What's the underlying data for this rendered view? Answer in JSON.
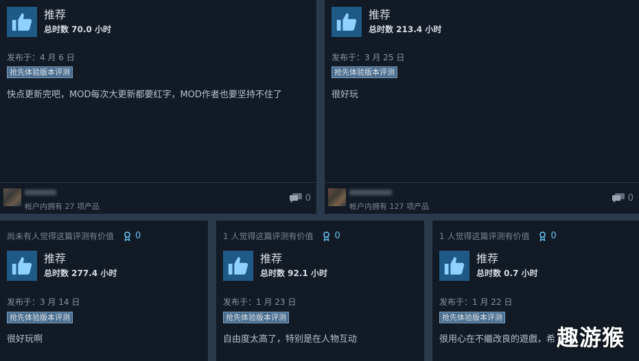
{
  "reviews_top": [
    {
      "recommendation": "推荐",
      "hours": "总时数 70.0 小时",
      "posted": "发布于：4 月 6 日",
      "badge": "抢先体验版本评测",
      "text": "快点更新完吧，MOD每次大更新都要红字，MOD作者也要坚持不住了",
      "owns": "帐户内拥有 27 项产品",
      "comments": "0"
    },
    {
      "recommendation": "推荐",
      "hours": "总时数 213.4 小时",
      "posted": "发布于：3 月 25 日",
      "badge": "抢先体验版本评测",
      "text": "很好玩",
      "owns": "帐户内拥有 127 项产品",
      "comments": "0"
    }
  ],
  "reviews_bottom": [
    {
      "helpful": "尚未有人觉得这篇评测有价值",
      "awards": "0",
      "recommendation": "推荐",
      "hours": "总时数 277.4 小时",
      "posted": "发布于：3 月 14 日",
      "badge": "抢先体验版本评测",
      "text": "很好玩啊"
    },
    {
      "helpful": "1 人觉得这篇评测有价值",
      "awards": "0",
      "recommendation": "推荐",
      "hours": "总时数 92.1 小时",
      "posted": "发布于：1 月 23 日",
      "badge": "抢先体验版本评测",
      "text": "自由度太高了，特别是在人物互动"
    },
    {
      "helpful": "1 人觉得这篇评测有价值",
      "awards": "0",
      "recommendation": "推荐",
      "hours": "总时数 0.7 小时",
      "posted": "发布于：1 月 22 日",
      "badge": "抢先体验版本评测",
      "text": "很用心在不繼改良的遊戲，希"
    }
  ],
  "watermark": "趣游猴",
  "icons": {
    "thumb": "thumbs-up-icon",
    "award": "award-icon",
    "comment": "comment-icon"
  },
  "colors": {
    "accent": "#66c0f4",
    "thumb_bg": "#1f5a87",
    "card_bg": "#121a25"
  }
}
